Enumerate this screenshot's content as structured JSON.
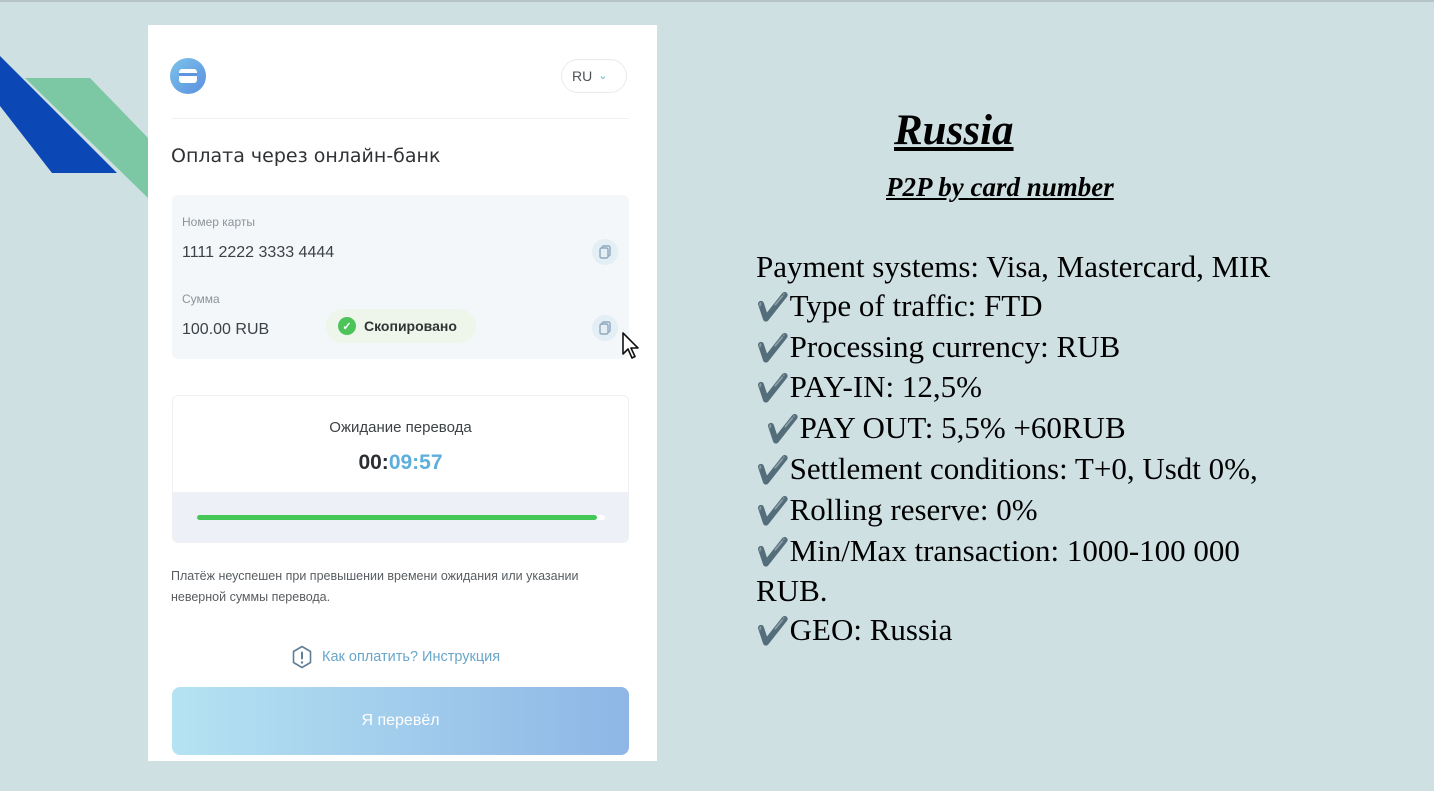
{
  "panel": {
    "language": "RU",
    "title": "Оплата через онлайн-банк",
    "card_label": "Номер карты",
    "card_number": "1111 2222 3333 4444",
    "amount_label": "Сумма",
    "amount_value": "100.00 RUB",
    "copied_toast": "Скопировано",
    "waiting_label": "Ожидание перевода",
    "timer_hours": "00:",
    "timer_rest": "09:57",
    "progress_fraction": 0.98,
    "note": "Платёж неуспешен при превышении времени ожидания или указании неверной суммы перевода.",
    "howto_link": "Как оплатить? Инструкция",
    "confirm_button": "Я перевёл"
  },
  "info": {
    "heading": "Russia",
    "subheading": "P2P by card number",
    "payment_systems": "Payment systems: Visa, Mastercard, MIR",
    "traffic": "Type of traffic: FTD",
    "currency": "Processing currency: RUB",
    "pay_in": "PAY-IN: 12,5%",
    "pay_out": "PAY OUT: 5,5% +60RUB",
    "settlement": "Settlement conditions: T+0, Usdt 0%,",
    "reserve": "Rolling reserve: 0%",
    "minmax": "Min/Max transaction: 1000-100 000",
    "minmax_cont": "RUB.",
    "geo": "GEO: Russia",
    "checkmark": "✔️"
  },
  "colors": {
    "background": "#cfe0e3",
    "accent_blue": "#0b47b5",
    "accent_green": "#7dc8a4",
    "progress_green": "#45c858",
    "timer_blue": "#5eaedb"
  }
}
